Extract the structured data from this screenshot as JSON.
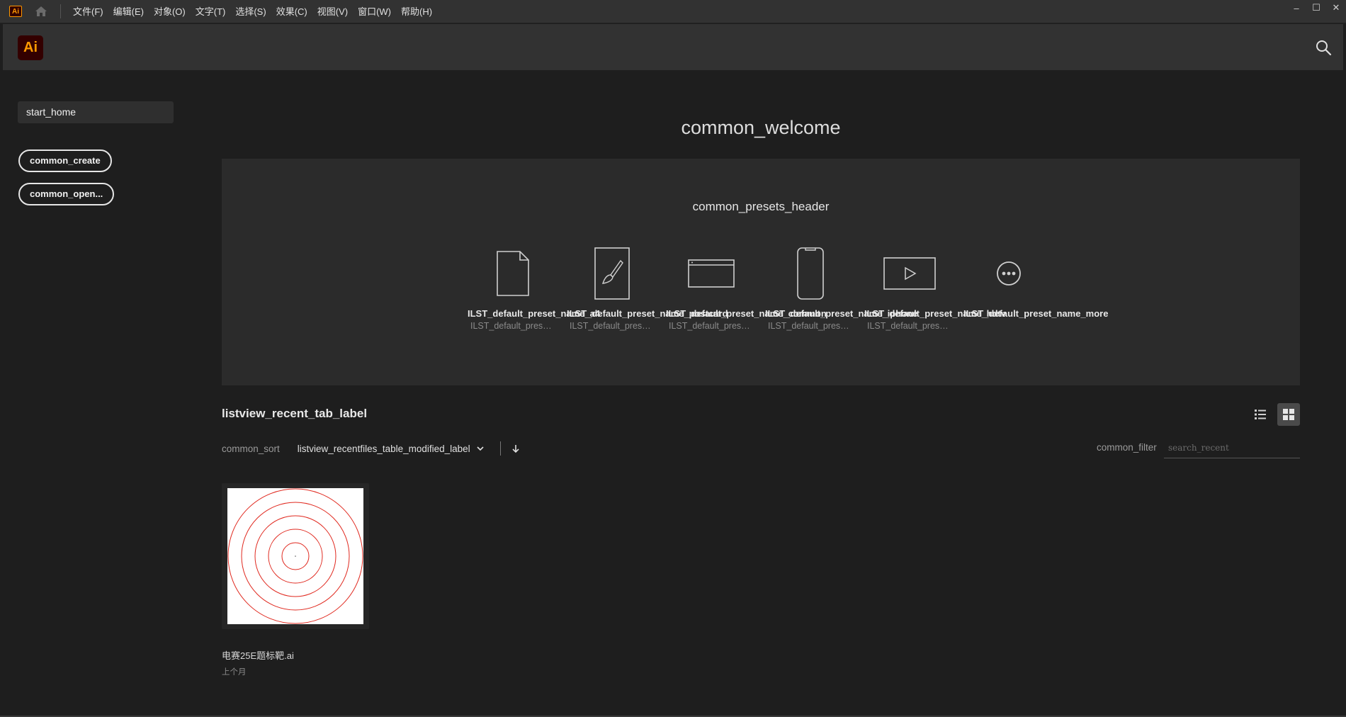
{
  "menubar": {
    "app_icon_label": "Ai",
    "items": [
      "文件(F)",
      "编辑(E)",
      "对象(O)",
      "文字(T)",
      "选择(S)",
      "效果(C)",
      "视图(V)",
      "窗口(W)",
      "帮助(H)"
    ],
    "window_controls": {
      "minimize": "–",
      "maximize": "☐",
      "close": "✕"
    }
  },
  "header": {
    "logo_label": "Ai",
    "search_icon": "search-icon"
  },
  "sidebar": {
    "home_label": "start_home",
    "create_label": "common_create",
    "open_label": "common_open..."
  },
  "main": {
    "welcome": "common_welcome",
    "presets_header": "common_presets_header",
    "presets": [
      {
        "name": "ILST_default_preset_name_a4",
        "desc": "ILST_default_preset...",
        "icon": "document-icon"
      },
      {
        "name": "ILST_default_preset_name_postcard",
        "desc": "ILST_default_preset...",
        "icon": "brush-icon"
      },
      {
        "name": "ILST_default_preset_name_common",
        "desc": "ILST_default_preset...",
        "icon": "web-icon"
      },
      {
        "name": "ILST_default_preset_name_iphone",
        "desc": "ILST_default_preset...",
        "icon": "phone-icon"
      },
      {
        "name": "ILST_default_preset_name_hdtv",
        "desc": "ILST_default_preset...",
        "icon": "video-icon"
      },
      {
        "name": "ILST_default_preset_name_more",
        "desc": "",
        "icon": "more-icon"
      }
    ],
    "recent_label": "listview_recent_tab_label",
    "sort_label": "common_sort",
    "sort_value": "listview_recentfiles_table_modified_label",
    "filter_label": "common_filter",
    "filter_placeholder": "search_recent",
    "files": [
      {
        "name": "电赛25E题标靶.ai",
        "date": "上个月"
      }
    ]
  },
  "colors": {
    "background": "#1e1e1e",
    "panel": "#2b2b2b",
    "bar": "#323232",
    "brand_orange": "#ff9a00",
    "brand_dark": "#330000",
    "target_rings": "#e0281e"
  }
}
